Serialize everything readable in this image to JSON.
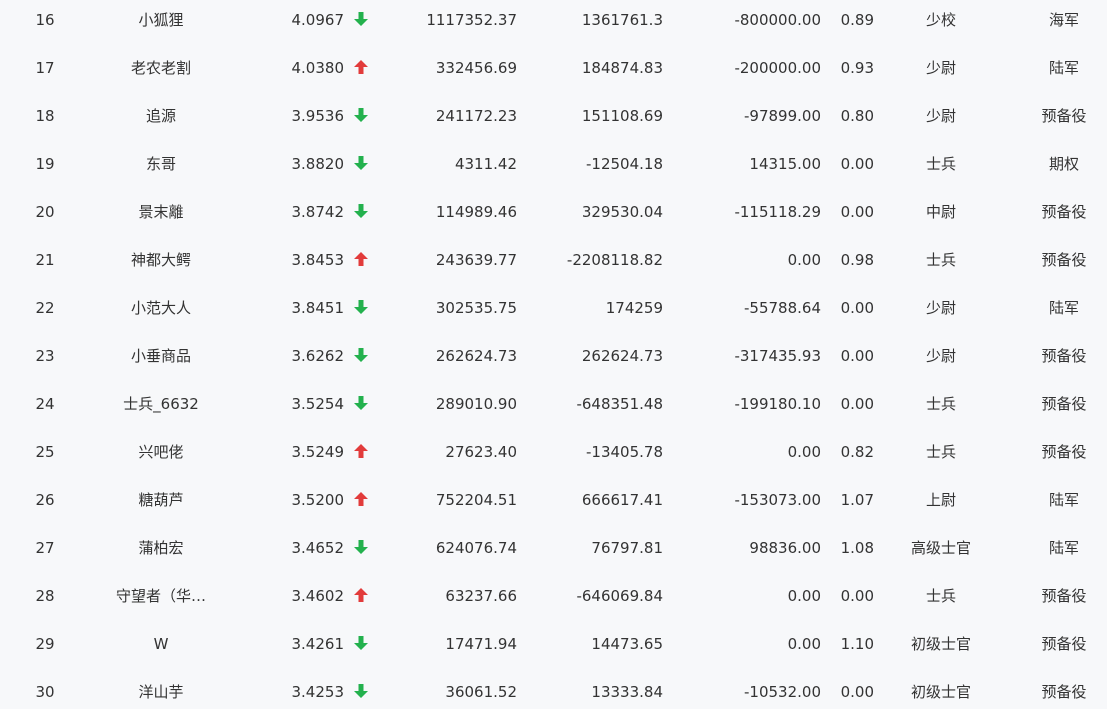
{
  "colors": {
    "up": "#e23b3b",
    "down": "#23b14d",
    "text": "#333333",
    "background": "#f7f8fa"
  },
  "rows": [
    {
      "rank": "16",
      "name": "小狐狸",
      "score": "4.0967",
      "trend": "down",
      "v1": "1117352.37",
      "v2": "1361761.3",
      "v3": "-800000.00",
      "ratio": "0.89",
      "military_rank": "少校",
      "branch": "海军"
    },
    {
      "rank": "17",
      "name": "老农老割",
      "score": "4.0380",
      "trend": "up",
      "v1": "332456.69",
      "v2": "184874.83",
      "v3": "-200000.00",
      "ratio": "0.93",
      "military_rank": "少尉",
      "branch": "陆军"
    },
    {
      "rank": "18",
      "name": "追源",
      "score": "3.9536",
      "trend": "down",
      "v1": "241172.23",
      "v2": "151108.69",
      "v3": "-97899.00",
      "ratio": "0.80",
      "military_rank": "少尉",
      "branch": "预备役"
    },
    {
      "rank": "19",
      "name": "东哥",
      "score": "3.8820",
      "trend": "down",
      "v1": "4311.42",
      "v2": "-12504.18",
      "v3": "14315.00",
      "ratio": "0.00",
      "military_rank": "士兵",
      "branch": "期权"
    },
    {
      "rank": "20",
      "name": "景末離",
      "score": "3.8742",
      "trend": "down",
      "v1": "114989.46",
      "v2": "329530.04",
      "v3": "-115118.29",
      "ratio": "0.00",
      "military_rank": "中尉",
      "branch": "预备役"
    },
    {
      "rank": "21",
      "name": "神都大鳄",
      "score": "3.8453",
      "trend": "up",
      "v1": "243639.77",
      "v2": "-2208118.82",
      "v3": "0.00",
      "ratio": "0.98",
      "military_rank": "士兵",
      "branch": "预备役"
    },
    {
      "rank": "22",
      "name": "小范大人",
      "score": "3.8451",
      "trend": "down",
      "v1": "302535.75",
      "v2": "174259",
      "v3": "-55788.64",
      "ratio": "0.00",
      "military_rank": "少尉",
      "branch": "陆军"
    },
    {
      "rank": "23",
      "name": "小垂商品",
      "score": "3.6262",
      "trend": "down",
      "v1": "262624.73",
      "v2": "262624.73",
      "v3": "-317435.93",
      "ratio": "0.00",
      "military_rank": "少尉",
      "branch": "预备役"
    },
    {
      "rank": "24",
      "name": "士兵_6632",
      "score": "3.5254",
      "trend": "down",
      "v1": "289010.90",
      "v2": "-648351.48",
      "v3": "-199180.10",
      "ratio": "0.00",
      "military_rank": "士兵",
      "branch": "预备役"
    },
    {
      "rank": "25",
      "name": "兴吧佬",
      "score": "3.5249",
      "trend": "up",
      "v1": "27623.40",
      "v2": "-13405.78",
      "v3": "0.00",
      "ratio": "0.82",
      "military_rank": "士兵",
      "branch": "预备役"
    },
    {
      "rank": "26",
      "name": "糖葫芦",
      "score": "3.5200",
      "trend": "up",
      "v1": "752204.51",
      "v2": "666617.41",
      "v3": "-153073.00",
      "ratio": "1.07",
      "military_rank": "上尉",
      "branch": "陆军"
    },
    {
      "rank": "27",
      "name": "蒲柏宏",
      "score": "3.4652",
      "trend": "down",
      "v1": "624076.74",
      "v2": "76797.81",
      "v3": "98836.00",
      "ratio": "1.08",
      "military_rank": "高级士官",
      "branch": "陆军"
    },
    {
      "rank": "28",
      "name": "守望者（华…",
      "score": "3.4602",
      "trend": "up",
      "v1": "63237.66",
      "v2": "-646069.84",
      "v3": "0.00",
      "ratio": "0.00",
      "military_rank": "士兵",
      "branch": "预备役"
    },
    {
      "rank": "29",
      "name": "W",
      "score": "3.4261",
      "trend": "down",
      "v1": "17471.94",
      "v2": "14473.65",
      "v3": "0.00",
      "ratio": "1.10",
      "military_rank": "初级士官",
      "branch": "预备役"
    },
    {
      "rank": "30",
      "name": "洋山芋",
      "score": "3.4253",
      "trend": "down",
      "v1": "36061.52",
      "v2": "13333.84",
      "v3": "-10532.00",
      "ratio": "0.00",
      "military_rank": "初级士官",
      "branch": "预备役"
    }
  ]
}
